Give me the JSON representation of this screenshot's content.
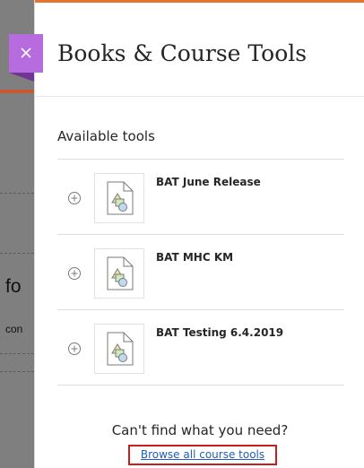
{
  "background": {
    "partial_text_bottom": "fo",
    "partial_text_small": "con"
  },
  "panel": {
    "title": "Books & Course Tools",
    "close_icon": "close-icon",
    "accent_color": "#e5742f",
    "close_color": "#b66bde"
  },
  "available_tools": {
    "label": "Available tools",
    "items": [
      {
        "name": "BAT June Release",
        "icon": "document-shapes-icon",
        "action_icon": "add-circle-icon"
      },
      {
        "name": "BAT MHC KM",
        "icon": "document-shapes-icon",
        "action_icon": "add-circle-icon"
      },
      {
        "name": "BAT Testing 6.4.2019",
        "icon": "document-shapes-icon",
        "action_icon": "add-circle-icon"
      }
    ]
  },
  "footer": {
    "question": "Can't find what you need?",
    "browse_link": "Browse all course tools",
    "link_color": "#1f5fb5",
    "highlight_color": "#c81e1e"
  }
}
